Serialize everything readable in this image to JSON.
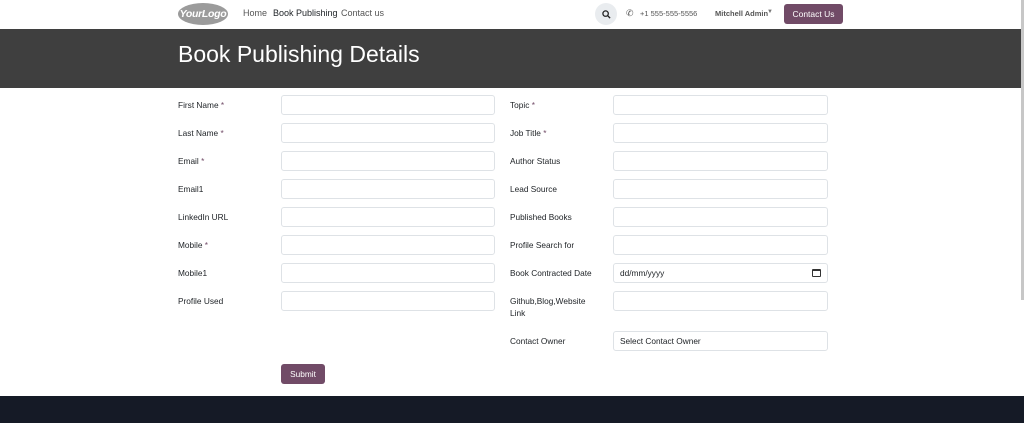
{
  "header": {
    "logo_text": "YourLogo",
    "nav": [
      "Home",
      "Book Publishing",
      "Contact us"
    ],
    "phone": "+1 555-555-5556",
    "user": "Mitchell Admin",
    "contact_button": "Contact Us"
  },
  "banner": {
    "title": "Book Publishing Details"
  },
  "form": {
    "left": [
      {
        "label": "First Name",
        "required": "*"
      },
      {
        "label": "Last Name",
        "required": "*"
      },
      {
        "label": "Email",
        "required": "*"
      },
      {
        "label": "Email1",
        "required": ""
      },
      {
        "label": "LinkedIn URL",
        "required": ""
      },
      {
        "label": "Mobile",
        "required": "*"
      },
      {
        "label": "Mobile1",
        "required": ""
      },
      {
        "label": "Profile Used",
        "required": ""
      }
    ],
    "right": [
      {
        "label": "Topic",
        "required": "*"
      },
      {
        "label": "Job Title",
        "required": "*"
      },
      {
        "label": "Author Status",
        "required": ""
      },
      {
        "label": "Lead Source",
        "required": ""
      },
      {
        "label": "Published Books",
        "required": ""
      },
      {
        "label": "Profile Search for",
        "required": ""
      },
      {
        "label": "Book Contracted Date",
        "required": "",
        "value": "dd/mm/yyyy"
      },
      {
        "label": "Github,Blog,Website",
        "label2": "Link",
        "required": ""
      },
      {
        "label": "Contact Owner",
        "required": "",
        "value": "Select Contact Owner"
      }
    ],
    "submit": "Submit"
  },
  "colors": {
    "accent": "#714b67",
    "banner": "#3f3f3f",
    "footer": "#151a26"
  }
}
